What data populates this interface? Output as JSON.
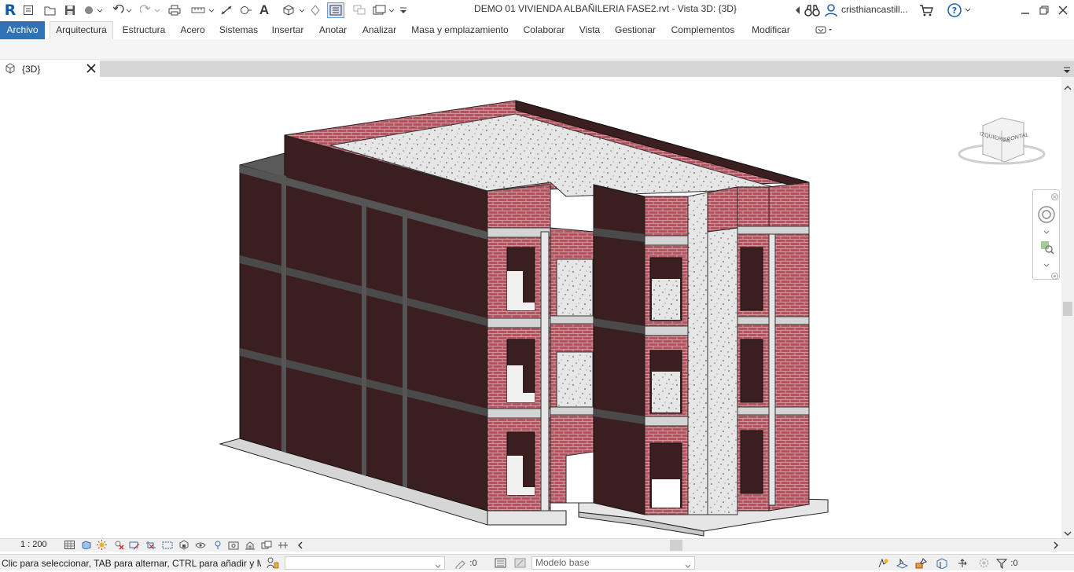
{
  "app": {
    "logo": "R"
  },
  "titlebar": {
    "title": "DEMO 01 VIVIENDA ALBAÑILERIA FASE2.rvt - Vista 3D: {3D}",
    "user": "cristhiancastill...",
    "help_icon": "?"
  },
  "menu": {
    "tabs": [
      {
        "label": "Archivo"
      },
      {
        "label": "Arquitectura"
      },
      {
        "label": "Estructura"
      },
      {
        "label": "Acero"
      },
      {
        "label": "Sistemas"
      },
      {
        "label": "Insertar"
      },
      {
        "label": "Anotar"
      },
      {
        "label": "Analizar"
      },
      {
        "label": "Masa y emplazamiento"
      },
      {
        "label": "Colaborar"
      },
      {
        "label": "Vista"
      },
      {
        "label": "Gestionar"
      },
      {
        "label": "Complementos"
      },
      {
        "label": "Modificar"
      }
    ],
    "active_tab": "Arquitectura"
  },
  "view_tab": {
    "label": "{3D}"
  },
  "viewcube": {
    "left_face": "IZQUIERDA",
    "front_face": "FRONTAL"
  },
  "view_control_bar": {
    "scale": "1 : 200"
  },
  "statusbar": {
    "message": "Clic para seleccionar, TAB para alternar, CTRL para añadir y MAYÚS",
    "worksharing_count": ":0",
    "model_combo": "Modelo base",
    "filter_count": ":0"
  },
  "colors": {
    "file_tab": "#2f73b6",
    "brick": "#b35561",
    "panel": "#3a1e20",
    "concrete": "#e5e5e5",
    "slab_edge": "#9a9a9a"
  }
}
